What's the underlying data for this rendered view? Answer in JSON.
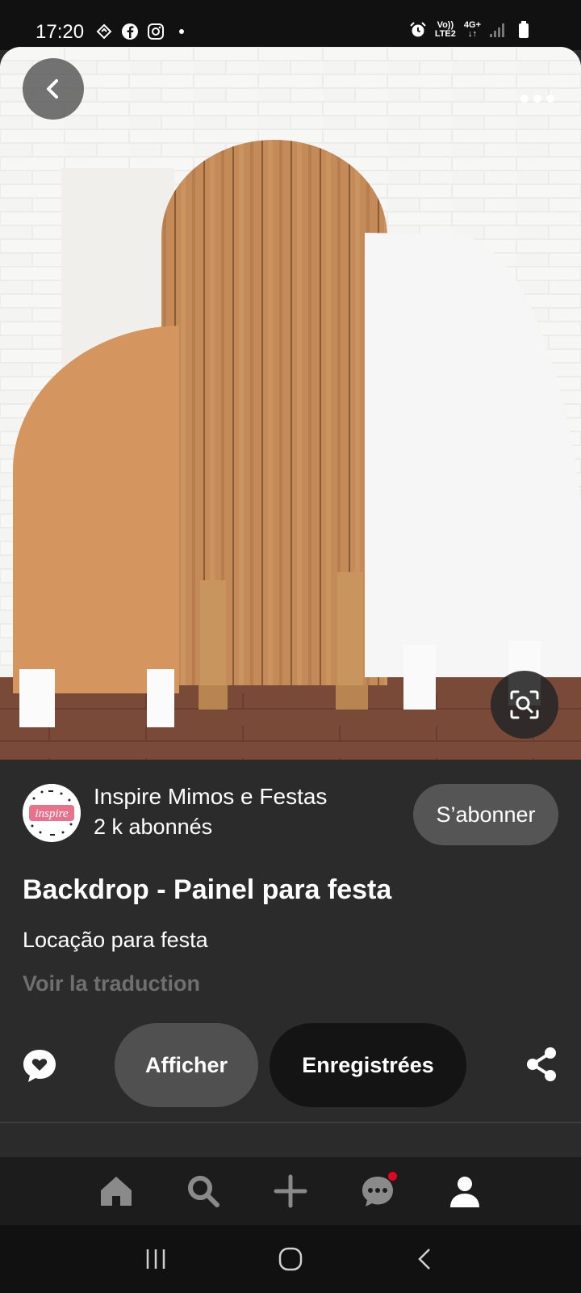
{
  "status": {
    "time": "17:20",
    "net_vo": "Vo))",
    "net_lte": "LTE2",
    "net_4g": "4G+"
  },
  "pin": {
    "creator_name": "Inspire Mimos e Festas",
    "creator_followers": "2 k abonnés",
    "avatar_text": "inspire",
    "subscribe_label": "S’abonner",
    "title": "Backdrop - Painel para festa",
    "description": "Locação para festa",
    "translate_label": "Voir la traduction"
  },
  "actions": {
    "show_label": "Afficher",
    "saved_label": "Enregistrées"
  },
  "bottom_nav": {
    "items": [
      "home-icon",
      "search-icon",
      "plus-icon",
      "chat-icon",
      "profile-icon"
    ]
  },
  "colors": {
    "background": "#2b2b2b",
    "button_grey": "#505050",
    "button_dark": "#141414",
    "notif_red": "#e60023",
    "translate_grey": "#6f6f6f"
  }
}
